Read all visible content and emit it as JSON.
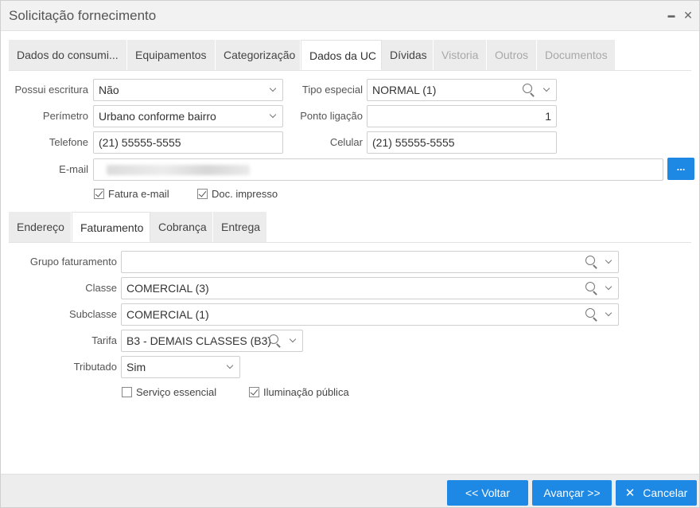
{
  "window": {
    "title": "Solicitação fornecimento",
    "minimize_glyph": "▬",
    "close_glyph": "✕"
  },
  "main_tabs": [
    {
      "label": "Dados do consumi...",
      "state": "normal"
    },
    {
      "label": "Equipamentos",
      "state": "normal"
    },
    {
      "label": "Categorização",
      "state": "normal"
    },
    {
      "label": "Dados da UC",
      "state": "active"
    },
    {
      "label": "Dívidas",
      "state": "normal"
    },
    {
      "label": "Vistoria",
      "state": "disabled"
    },
    {
      "label": "Outros",
      "state": "disabled"
    },
    {
      "label": "Documentos",
      "state": "disabled"
    }
  ],
  "uc_form": {
    "possui_escritura": {
      "label": "Possui escritura",
      "value": "Não"
    },
    "tipo_especial": {
      "label": "Tipo especial",
      "value": "NORMAL (1)"
    },
    "perimetro": {
      "label": "Perímetro",
      "value": "Urbano conforme bairro"
    },
    "ponto_ligacao": {
      "label": "Ponto ligação",
      "value": "1"
    },
    "telefone": {
      "label": "Telefone",
      "value": "(21) 55555-5555"
    },
    "celular": {
      "label": "Celular",
      "value": "(21) 55555-5555"
    },
    "email": {
      "label": "E-mail",
      "button_label": "..."
    },
    "fatura_email": {
      "label": "Fatura e-mail",
      "checked": true
    },
    "doc_impresso": {
      "label": "Doc. impresso",
      "checked": true
    }
  },
  "sub_tabs": [
    {
      "label": "Endereço",
      "state": "normal"
    },
    {
      "label": "Faturamento",
      "state": "active"
    },
    {
      "label": "Cobrança",
      "state": "normal"
    },
    {
      "label": "Entrega",
      "state": "normal"
    }
  ],
  "billing": {
    "grupo_faturamento": {
      "label": "Grupo faturamento",
      "value": ""
    },
    "classe": {
      "label": "Classe",
      "value": "COMERCIAL (3)"
    },
    "subclasse": {
      "label": "Subclasse",
      "value": "COMERCIAL (1)"
    },
    "tarifa": {
      "label": "Tarifa",
      "value": "B3 - DEMAIS CLASSES (B3)"
    },
    "tributado": {
      "label": "Tributado",
      "value": "Sim"
    },
    "servico_essencial": {
      "label": "Serviço essencial",
      "checked": false
    },
    "iluminacao_publica": {
      "label": "Iluminação pública",
      "checked": true
    }
  },
  "footer": {
    "voltar": "<< Voltar",
    "avancar": "Avançar >>",
    "cancelar": "Cancelar",
    "cancel_glyph": "✕"
  },
  "colors": {
    "accent": "#1e88e5",
    "tab_bg": "#ececec",
    "disabled_text": "#a8a8a8"
  }
}
